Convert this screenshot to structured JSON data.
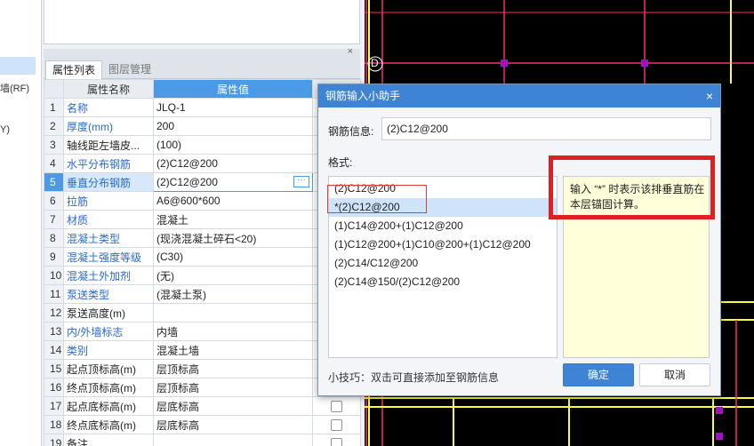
{
  "left_strip": {
    "items": [
      "墙(RF)",
      "Y)"
    ]
  },
  "panel": {
    "close": "×",
    "tabs": [
      "属性列表",
      "图层管理"
    ],
    "columns": [
      "属性名称",
      "属性值"
    ],
    "rows": [
      {
        "num": "1",
        "name": "名称",
        "value": "JLQ-1",
        "blue": true,
        "checkbox": false
      },
      {
        "num": "2",
        "name": "厚度(mm)",
        "value": "200",
        "blue": true,
        "checkbox": false
      },
      {
        "num": "3",
        "name": "轴线距左墙皮...",
        "value": "(100)",
        "blue": false,
        "checkbox": false
      },
      {
        "num": "4",
        "name": "水平分布钢筋",
        "value": "(2)C12@200",
        "blue": true,
        "checkbox": false
      },
      {
        "num": "5",
        "name": "垂直分布钢筋",
        "value": "(2)C12@200",
        "blue": true,
        "checkbox": false
      },
      {
        "num": "6",
        "name": "拉筋",
        "value": "A6@600*600",
        "blue": true,
        "checkbox": false
      },
      {
        "num": "7",
        "name": "材质",
        "value": "混凝土",
        "blue": true,
        "checkbox": false
      },
      {
        "num": "8",
        "name": "混凝土类型",
        "value": "(现浇混凝土碎石<20)",
        "blue": true,
        "checkbox": false
      },
      {
        "num": "9",
        "name": "混凝土强度等级",
        "value": "(C30)",
        "blue": true,
        "checkbox": false
      },
      {
        "num": "10",
        "name": "混凝土外加剂",
        "value": "(无)",
        "blue": true,
        "checkbox": false
      },
      {
        "num": "11",
        "name": "泵送类型",
        "value": "(混凝土泵)",
        "blue": true,
        "checkbox": false
      },
      {
        "num": "12",
        "name": "泵送高度(m)",
        "value": "",
        "blue": false,
        "checkbox": false
      },
      {
        "num": "13",
        "name": "内/外墙标志",
        "value": "内墙",
        "blue": true,
        "checkbox": false
      },
      {
        "num": "14",
        "name": "类别",
        "value": "混凝土墙",
        "blue": true,
        "checkbox": false
      },
      {
        "num": "15",
        "name": "起点顶标高(m)",
        "value": "层顶标高",
        "blue": false,
        "checkbox": false
      },
      {
        "num": "16",
        "name": "终点顶标高(m)",
        "value": "层顶标高",
        "blue": false,
        "checkbox": false
      },
      {
        "num": "17",
        "name": "起点底标高(m)",
        "value": "层底标高",
        "blue": false,
        "checkbox": true
      },
      {
        "num": "18",
        "name": "终点底标高(m)",
        "value": "层底标高",
        "blue": false,
        "checkbox": true
      },
      {
        "num": "19",
        "name": "备注",
        "value": "",
        "blue": false,
        "checkbox": true
      }
    ],
    "selected_row": 5,
    "ellipsis": "···"
  },
  "cad": {
    "axis_label": "D",
    "background": "#000000",
    "grid_color": "#ff2a6d",
    "wall_color": "#ffff33",
    "node_color": "#a010c8"
  },
  "dialog": {
    "title": "钢筋输入小助手",
    "close": "×",
    "rebar_label": "钢筋信息:",
    "rebar_value": "(2)C12@200",
    "format_label": "格式:",
    "formats": [
      "(2)C12@200",
      "*(2)C12@200",
      "(1)C14@200+(1)C12@200",
      "(1)C12@200+(1)C10@200+(1)C12@200",
      "(2)C14/C12@200",
      "(2)C14@150/(2)C12@200"
    ],
    "selected_format": 1,
    "hint": "输入 “*” 时表示该排垂直筋在本层锚固计算。",
    "tip": "小技巧：双击可直接添加至钢筋信息",
    "ok_label": "确定",
    "cancel_label": "取消"
  }
}
